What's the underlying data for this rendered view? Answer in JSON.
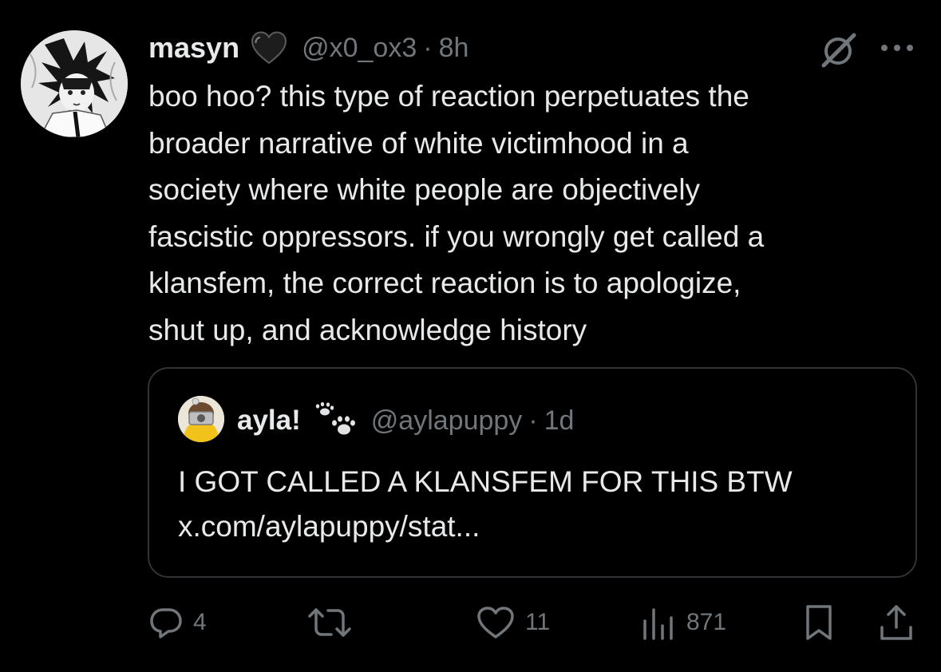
{
  "post": {
    "author_name": "masyn",
    "handle": "@x0_ox3",
    "separator": "·",
    "time": "8h",
    "text": "boo hoo? this type of reaction perpetuates the\nbroader narrative of white victimhood in a\nsociety where white people are objectively\nfascistic oppressors. if you wrongly get called a\nklansfem, the correct reaction is to apologize,\nshut up, and acknowledge history"
  },
  "quote": {
    "author_name": "ayla!",
    "handle": "@aylapuppy",
    "separator": "·",
    "time": "1d",
    "text": "I GOT CALLED A KLANSFEM FOR THIS BTW\nx.com/aylapuppy/stat..."
  },
  "actions": {
    "replies": "4",
    "likes": "11",
    "views": "871"
  },
  "icons": {
    "author_badge": "black-heart-icon",
    "quote_badge": "paw-prints-icon",
    "top_right": [
      "grok-icon",
      "more-icon"
    ],
    "bar": [
      "reply-icon",
      "retweet-icon",
      "like-icon",
      "views-icon",
      "bookmark-icon",
      "share-icon"
    ]
  },
  "colors": {
    "background": "#000000",
    "text": "#e7e9ea",
    "secondary": "#71767b",
    "border": "#2f3336"
  }
}
